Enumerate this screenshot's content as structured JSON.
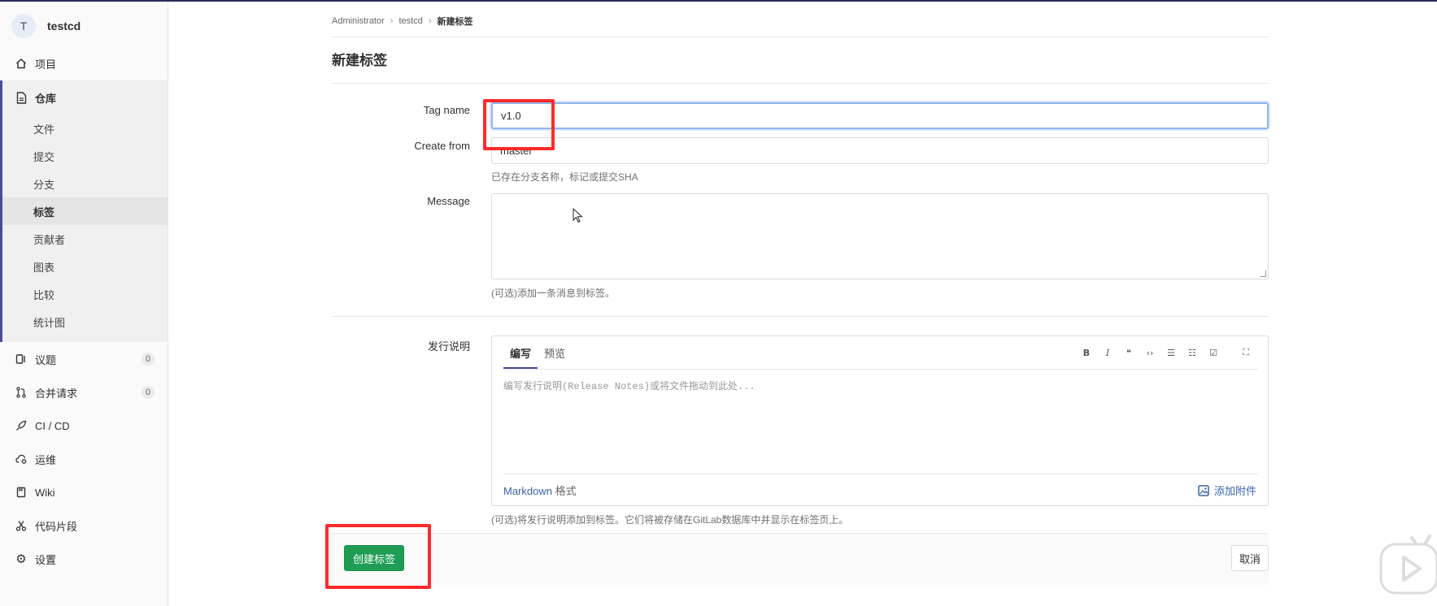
{
  "sidebar": {
    "project_avatar": "T",
    "project_name": "testcd",
    "items": [
      {
        "label": "项目",
        "icon": "home-icon"
      },
      {
        "label": "仓库",
        "icon": "document-icon"
      },
      {
        "label": "议题",
        "icon": "issues-icon",
        "count": "0"
      },
      {
        "label": "合并请求",
        "icon": "merge-request-icon",
        "count": "0"
      },
      {
        "label": "CI / CD",
        "icon": "rocket-icon"
      },
      {
        "label": "运维",
        "icon": "cloud-gear-icon"
      },
      {
        "label": "Wiki",
        "icon": "book-icon"
      },
      {
        "label": "代码片段",
        "icon": "scissors-icon"
      },
      {
        "label": "设置",
        "icon": "gear-icon"
      }
    ],
    "repo_subitems": [
      "文件",
      "提交",
      "分支",
      "标签",
      "贡献者",
      "图表",
      "比较",
      "统计图"
    ]
  },
  "breadcrumb": {
    "items": [
      "Administrator",
      "testcd",
      "新建标签"
    ]
  },
  "page": {
    "title": "新建标签"
  },
  "form": {
    "tag_name_label": "Tag name",
    "tag_name_value": "v1.0",
    "create_from_label": "Create from",
    "create_from_value": "master",
    "create_from_help": "已存在分支名称，标记或提交SHA",
    "message_label": "Message",
    "message_help": "(可选)添加一条消息到标签。",
    "release_label": "发行说明",
    "release_help": "(可选)将发行说明添加到标签。它们将被存储在GitLab数据库中并显示在标签页上。"
  },
  "editor": {
    "tab_write": "编写",
    "tab_preview": "预览",
    "placeholder": "编写发行说明(Release Notes)或将文件拖动到此处...",
    "markdown_link": "Markdown",
    "markdown_suffix": " 格式",
    "attach_label": "添加附件",
    "toolbar": [
      "B",
      "I",
      "❝",
      "‹›",
      "☰",
      "☷",
      "☑",
      "⛶"
    ]
  },
  "actions": {
    "create_label": "创建标签",
    "cancel_label": "取消"
  },
  "colors": {
    "primary_button": "#1f9d55",
    "annotation_red": "#ff2a2a",
    "nav_accent": "#4b4ba0",
    "link": "#3b63a8"
  }
}
